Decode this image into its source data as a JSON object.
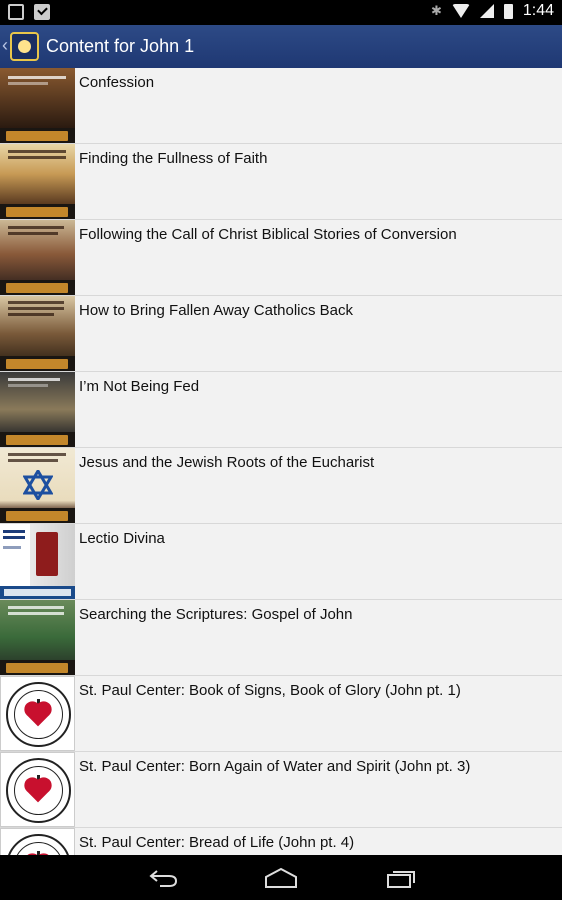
{
  "status_bar": {
    "time": "1:44",
    "icons": [
      "image-icon",
      "check-clipboard-icon",
      "bluetooth-icon",
      "wifi-icon",
      "signal-icon",
      "battery-icon"
    ]
  },
  "action_bar": {
    "title": "Content for John 1",
    "icon": "app-logo-icon"
  },
  "items": [
    {
      "label": "Confession",
      "cover_title": "CONFESSION",
      "thumb_type": "lighthouse"
    },
    {
      "label": "Finding the Fullness of Faith",
      "cover_title": "FINDING THE FULLNESS OF FAITH",
      "thumb_type": "lighthouse"
    },
    {
      "label": "Following the Call of Christ Biblical Stories of Conversion",
      "cover_title": "FOLLOWING THE CALL OF CHRIST",
      "thumb_type": "lighthouse"
    },
    {
      "label": "How to Bring Fallen Away Catholics Back",
      "cover_title": "HOW TO BRING FALLEN-AWAY CATHOLICS BACK TO THE CHURCH",
      "thumb_type": "lighthouse"
    },
    {
      "label": "I’m Not Being Fed",
      "cover_title": "I’M NOT BEING FED",
      "thumb_type": "lighthouse"
    },
    {
      "label": "Jesus and the Jewish Roots of the Eucharist",
      "cover_title": "JESUS AND THE JEWISH ROOTS OF THE EUCHARIST",
      "thumb_type": "star"
    },
    {
      "label": "Lectio Divina",
      "cover_title": "Lectio Divina",
      "thumb_type": "truth"
    },
    {
      "label": "Searching the Scriptures: Gospel of John",
      "cover_title": "SEARCHING THE SCRIPTURES",
      "thumb_type": "lighthouse"
    },
    {
      "label": "St. Paul Center: Book of Signs, Book of Glory (John pt. 1)",
      "cover_title": "ST. PAUL CENTER",
      "thumb_type": "seal"
    },
    {
      "label": "St. Paul Center: Born Again of Water and Spirit (John pt. 3)",
      "cover_title": "ST. PAUL CENTER",
      "thumb_type": "seal"
    },
    {
      "label": "St. Paul Center: Bread of Life (John pt. 4)",
      "cover_title": "ST. PAUL CENTER",
      "thumb_type": "seal"
    }
  ],
  "nav_bar": {
    "icons": [
      "back-icon",
      "home-icon",
      "recent-apps-icon"
    ]
  },
  "colors": {
    "action_bar": "#2a4580",
    "list_background": "#f2f2f2",
    "divider": "#d8d8d8",
    "lighthouse_logo": "#c3872b",
    "seal_heart": "#c8102e"
  }
}
